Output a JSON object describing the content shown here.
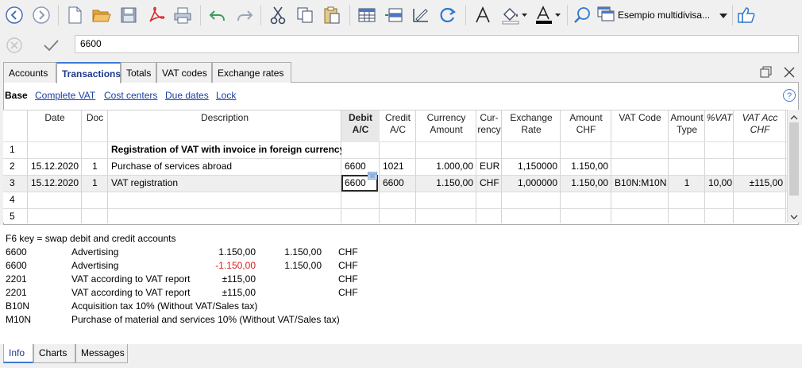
{
  "toolbar": {
    "file_name": "Esempio multidivisa...",
    "icons": [
      "back-icon",
      "forward-icon",
      "new-file-icon",
      "open-folder-icon",
      "save-icon",
      "pdf-icon",
      "print-icon",
      "undo-icon",
      "redo-icon",
      "cut-icon",
      "copy-icon",
      "paste-icon",
      "add-rows-icon",
      "insert-row-icon",
      "edit-icon",
      "refresh-icon",
      "text-format-icon",
      "fill-color-icon",
      "font-color-icon",
      "search-icon",
      "thumbs-up-icon"
    ]
  },
  "input": {
    "value": "6600"
  },
  "tabs": [
    "Accounts",
    "Transactions",
    "Totals",
    "VAT codes",
    "Exchange rates"
  ],
  "views": [
    "Base",
    "Complete VAT",
    "Cost centers",
    "Due dates",
    "Lock"
  ],
  "columns": {
    "date": "Date",
    "doc": "Doc",
    "description": "Description",
    "debit": "Debit\nA/C",
    "credit": "Credit\nA/C",
    "currency_amount": "Currency\nAmount",
    "currency": "Cur-\nrency",
    "exchange_rate": "Exchange\nRate",
    "amount_chf": "Amount\nCHF",
    "vat_code": "VAT Code",
    "amount_type": "Amount\nType",
    "pct_vat": "%VAT",
    "vat_acc_chf": "VAT Acc\nCHF"
  },
  "rows": [
    {
      "n": "1",
      "date": "",
      "doc": "",
      "description": "Registration of VAT with invoice in foreign currency",
      "debit": "",
      "credit": "",
      "currency_amount": "",
      "currency": "",
      "exchange_rate": "",
      "amount_chf": "",
      "vat_code": "",
      "amount_type": "",
      "pct_vat": "",
      "vat_acc_chf": ""
    },
    {
      "n": "2",
      "date": "15.12.2020",
      "doc": "1",
      "description": "Purchase of services abroad",
      "debit": "6600",
      "credit": "1021",
      "currency_amount": "1.000,00",
      "currency": "EUR",
      "exchange_rate": "1,150000",
      "amount_chf": "1.150,00",
      "vat_code": "",
      "amount_type": "",
      "pct_vat": "",
      "vat_acc_chf": ""
    },
    {
      "n": "3",
      "date": "15.12.2020",
      "doc": "1",
      "description": "VAT registration",
      "debit": "6600",
      "credit": "6600",
      "currency_amount": "1.150,00",
      "currency": "CHF",
      "exchange_rate": "1,000000",
      "amount_chf": "1.150,00",
      "vat_code": "B10N:M10N",
      "amount_type": "1",
      "pct_vat": "10,00",
      "vat_acc_chf": "±115,00"
    },
    {
      "n": "4",
      "date": "",
      "doc": "",
      "description": "",
      "debit": "",
      "credit": "",
      "currency_amount": "",
      "currency": "",
      "exchange_rate": "",
      "amount_chf": "",
      "vat_code": "",
      "amount_type": "",
      "pct_vat": "",
      "vat_acc_chf": ""
    },
    {
      "n": "5",
      "date": "",
      "doc": "",
      "description": "",
      "debit": "",
      "credit": "",
      "currency_amount": "",
      "currency": "",
      "exchange_rate": "",
      "amount_chf": "",
      "vat_code": "",
      "amount_type": "",
      "pct_vat": "",
      "vat_acc_chf": ""
    }
  ],
  "info": {
    "hint": "F6 key = swap debit and credit accounts",
    "lines": [
      {
        "account": "6600",
        "description": "Advertising",
        "amount": "1.150,00",
        "amount2": "1.150,00",
        "currency": "CHF"
      },
      {
        "account": "6600",
        "description": "Advertising",
        "amount": "-1.150,00",
        "amount2": "1.150,00",
        "currency": "CHF"
      },
      {
        "account": "2201",
        "description": "VAT according to VAT report",
        "amount": "±115,00",
        "amount2": "",
        "currency": "CHF"
      },
      {
        "account": "2201",
        "description": "VAT according to VAT report",
        "amount": "±115,00",
        "amount2": "",
        "currency": "CHF"
      }
    ],
    "codes": [
      {
        "code": "B10N",
        "text": "Acquisition tax 10% (Without VAT/Sales tax)"
      },
      {
        "code": "M10N",
        "text": "Purchase of material and services 10% (Without VAT/Sales tax)"
      }
    ]
  },
  "bottom_tabs": [
    "Info",
    "Charts",
    "Messages"
  ],
  "colors": {
    "accent": "#3d7bd6",
    "link": "#1a40a8",
    "negative": "#d81e1e",
    "pdf": "#d42a2a",
    "folder": "#e8a43a",
    "undo": "#3a9e5a"
  }
}
